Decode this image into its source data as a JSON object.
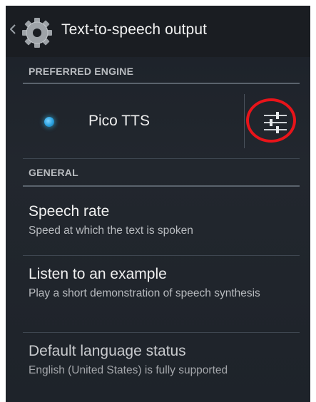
{
  "actionbar": {
    "title": "Text-to-speech output",
    "back_icon": "chevron-left-icon",
    "app_icon": "gear-icon"
  },
  "sections": {
    "preferred_engine": "PREFERRED ENGINE",
    "general": "GENERAL"
  },
  "engine": {
    "label": "Pico TTS",
    "selected": true,
    "settings_icon": "sliders-icon"
  },
  "preferences": [
    {
      "title": "Speech rate",
      "summary": "Speed at which the text is spoken"
    },
    {
      "title": "Listen to an example",
      "summary": "Play a short demonstration of speech synthesis"
    },
    {
      "title": "Default language status",
      "summary": "English (United States) is fully supported"
    }
  ],
  "colors": {
    "accent": "#33b5e5",
    "highlight": "#e8141a",
    "background": "#22272e"
  }
}
